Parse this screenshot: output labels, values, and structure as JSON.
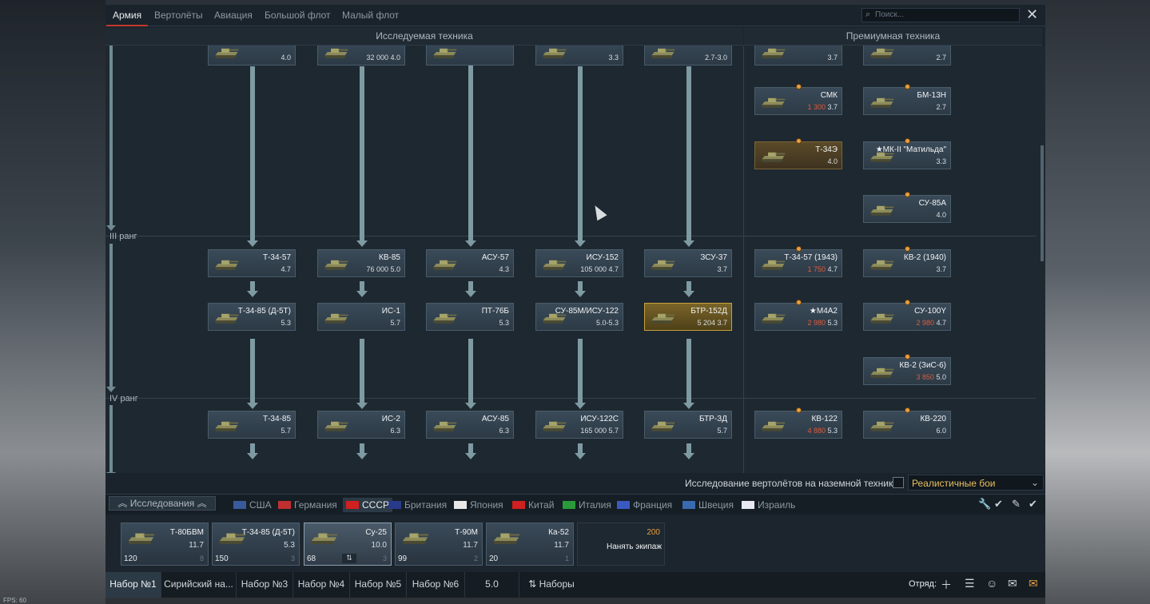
{
  "top_tabs": [
    "Армия",
    "Вертолёты",
    "Авиация",
    "Большой флот",
    "Малый флот"
  ],
  "search_placeholder": "Поиск...",
  "headers": {
    "researched": "Исследуемая техника",
    "premium": "Премиумная техника"
  },
  "ranks": {
    "r3": "III ранг",
    "r4": "IV ранг"
  },
  "researched_top": [
    {
      "name": "",
      "br": "4.0"
    },
    {
      "name": "",
      "rp": "32 000",
      "br": "4.0"
    },
    {
      "name": "",
      "br": ""
    },
    {
      "name": "",
      "br": "3.3"
    },
    {
      "name": "",
      "br": "2.7-3.0"
    }
  ],
  "researched_r3a": [
    {
      "name": "Т-34-57",
      "br": "4.7"
    },
    {
      "name": "КВ-85",
      "rp": "76 000",
      "br": "5.0"
    },
    {
      "name": "АСУ-57",
      "br": "4.3"
    },
    {
      "name": "ИСУ-152",
      "rp": "105 000",
      "br": "4.7"
    },
    {
      "name": "ЗСУ-37",
      "br": "3.7"
    }
  ],
  "researched_r3b": [
    {
      "name": "Т-34-85 (Д-5Т)",
      "br": "5.3"
    },
    {
      "name": "ИС-1",
      "br": "5.7"
    },
    {
      "name": "ПТ-76Б",
      "br": "5.3"
    },
    {
      "name": "СУ-85М/ИСУ-122",
      "br": "5.0-5.3"
    },
    {
      "name": "БТР-152Д",
      "rp": "5 204",
      "br": "3.7"
    }
  ],
  "researched_r4": [
    {
      "name": "Т-34-85",
      "br": "5.7"
    },
    {
      "name": "ИС-2",
      "br": "6.3"
    },
    {
      "name": "АСУ-85",
      "br": "6.3"
    },
    {
      "name": "ИСУ-122С",
      "rp": "165 000",
      "br": "5.7"
    },
    {
      "name": "БТР-ЗД",
      "br": "5.7"
    }
  ],
  "premium": [
    {
      "name": "",
      "cost": "",
      "br": "3.7"
    },
    {
      "name": "",
      "cost": "",
      "br": "2.7"
    },
    {
      "name": "СМК",
      "cost": "1 300",
      "br": "3.7"
    },
    {
      "name": "БМ-13Н",
      "cost": "",
      "br": "2.7"
    },
    {
      "name": "Т-34Э",
      "cost": "",
      "br": "4.0"
    },
    {
      "name": "★МК-II \"Матильда\"",
      "cost": "",
      "br": "3.3"
    },
    {
      "name": "СУ-85А",
      "cost": "",
      "br": "4.0"
    },
    {
      "name": "Т-34-57 (1943)",
      "cost": "1 750",
      "br": "4.7"
    },
    {
      "name": "КВ-2 (1940)",
      "cost": "",
      "br": "3.7"
    },
    {
      "name": "★М4А2",
      "cost": "2 980",
      "br": "5.3"
    },
    {
      "name": "СУ-100Y",
      "cost": "2 980",
      "br": "4.7"
    },
    {
      "name": "КВ-2 (ЗиС-6)",
      "cost": "3 850",
      "br": "5.0"
    },
    {
      "name": "КВ-122",
      "cost": "4 880",
      "br": "5.3"
    },
    {
      "name": "КВ-220",
      "cost": "",
      "br": "6.0"
    }
  ],
  "heli_option": "Исследование вертолётов на наземной технике",
  "mode": "Реалистичные бои",
  "research_label": "Исследования",
  "nations": [
    "США",
    "Германия",
    "СССР",
    "Британия",
    "Япония",
    "Китай",
    "Италия",
    "Франция",
    "Швеция",
    "Израиль"
  ],
  "crew": [
    {
      "name": "Т-80БВМ",
      "br": "11.7",
      "count": "120",
      "lvl": "8"
    },
    {
      "name": "Т-34-85 (Д-5Т)",
      "br": "5.3",
      "count": "150",
      "lvl": "3"
    },
    {
      "name": "Су-25",
      "br": "10.0",
      "count": "68",
      "lvl": "3"
    },
    {
      "name": "Т-90М",
      "br": "11.7",
      "count": "99",
      "lvl": "2"
    },
    {
      "name": "Ка-52",
      "br": "11.7",
      "count": "20",
      "lvl": "1"
    }
  ],
  "hire": {
    "cost": "200",
    "label": "Нанять экипаж"
  },
  "presets": [
    "Набор №1",
    "Сирийский на...",
    "Набор №3",
    "Набор №4",
    "Набор №5",
    "Набор №6"
  ],
  "preset_br": "5.0",
  "presets_btn": "Наборы",
  "squad_label": "Отряд:",
  "fps": "FPS: 60",
  "colors": {
    "accent": "#c0392b",
    "premium": "#5a4a28",
    "gold": "#e05a3a"
  }
}
